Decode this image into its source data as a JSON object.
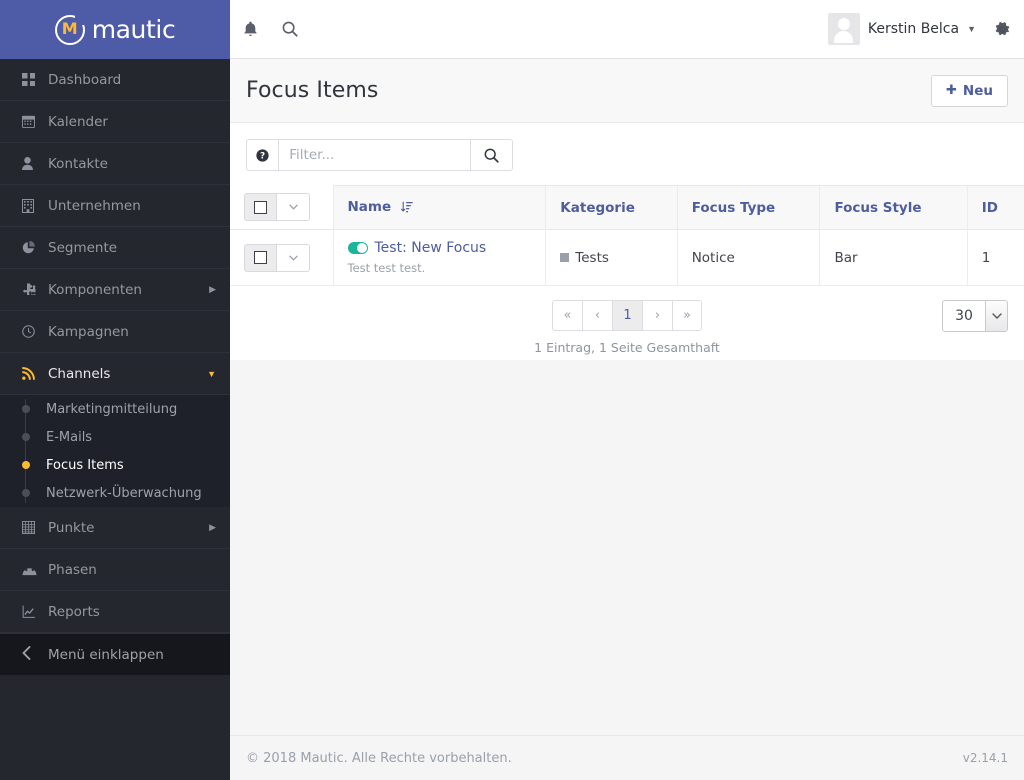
{
  "brand": {
    "name": "mautic",
    "logo_letter": "M",
    "bar_color": "#4e5ba6",
    "accent_color": "#fdb933"
  },
  "sidebar": {
    "items": [
      {
        "label": "Dashboard",
        "icon": "grid-icon",
        "has_children": false
      },
      {
        "label": "Kalender",
        "icon": "calendar-icon",
        "has_children": false
      },
      {
        "label": "Kontakte",
        "icon": "user-icon",
        "has_children": false
      },
      {
        "label": "Unternehmen",
        "icon": "building-icon",
        "has_children": false
      },
      {
        "label": "Segmente",
        "icon": "pie-chart-icon",
        "has_children": false
      },
      {
        "label": "Komponenten",
        "icon": "puzzle-icon",
        "has_children": true,
        "caret": "caret-right-icon"
      },
      {
        "label": "Kampagnen",
        "icon": "clock-icon",
        "has_children": false
      },
      {
        "label": "Channels",
        "icon": "rss-icon",
        "has_children": true,
        "caret": "caret-down-icon",
        "open": true
      }
    ],
    "channels_submenu": [
      {
        "label": "Marketingmitteilung",
        "active": false
      },
      {
        "label": "E-Mails",
        "active": false
      },
      {
        "label": "Focus Items",
        "active": true
      },
      {
        "label": "Netzwerk-Überwachung",
        "active": false
      }
    ],
    "items_after": [
      {
        "label": "Punkte",
        "icon": "table-icon",
        "has_children": true,
        "caret": "caret-right-icon"
      },
      {
        "label": "Phasen",
        "icon": "dashboard-icon",
        "has_children": false
      },
      {
        "label": "Reports",
        "icon": "line-chart-icon",
        "has_children": false
      }
    ],
    "collapse": {
      "label": "Menü einklappen",
      "icon": "chevron-left-icon"
    }
  },
  "topbar": {
    "notification_icon": "bell-icon",
    "search_icon": "search-icon",
    "user_name": "Kerstin Belca",
    "user_caret": "caret-down-icon",
    "settings_icon": "gear-icon",
    "avatar": "avatar-icon"
  },
  "page": {
    "title": "Focus Items",
    "new_button": {
      "label": "Neu",
      "icon": "plus-icon"
    }
  },
  "toolbar": {
    "help_icon": "question-circle-icon",
    "filter_placeholder": "Filter...",
    "filter_value": "",
    "search_icon": "search-icon"
  },
  "table": {
    "columns": [
      {
        "label": "",
        "name": "select"
      },
      {
        "label": "Name",
        "name": "name",
        "sort_icon": "sort-amount-desc-icon",
        "sorted": true
      },
      {
        "label": "Kategorie",
        "name": "category"
      },
      {
        "label": "Focus Type",
        "name": "focus-type"
      },
      {
        "label": "Focus Style",
        "name": "focus-style"
      },
      {
        "label": "ID",
        "name": "id"
      }
    ],
    "rows": [
      {
        "published": true,
        "name": "Test: New Focus",
        "description": "Test test test.",
        "category": "Tests",
        "category_color": "#9aa0aa",
        "focus_type": "Notice",
        "focus_style": "Bar",
        "id": "1"
      }
    ]
  },
  "pagination": {
    "buttons": [
      {
        "label": "«",
        "name": "first",
        "active": false
      },
      {
        "label": "‹",
        "name": "previous",
        "active": false
      },
      {
        "label": "1",
        "name": "page-1",
        "active": true
      },
      {
        "label": "›",
        "name": "next",
        "active": false
      },
      {
        "label": "»",
        "name": "last",
        "active": false
      }
    ],
    "info": "1 Eintrag, 1 Seite Gesamthaft",
    "limit_value": "30"
  },
  "footer": {
    "copyright": "© 2018 Mautic. Alle Rechte vorbehalten.",
    "version": "v2.14.1"
  }
}
